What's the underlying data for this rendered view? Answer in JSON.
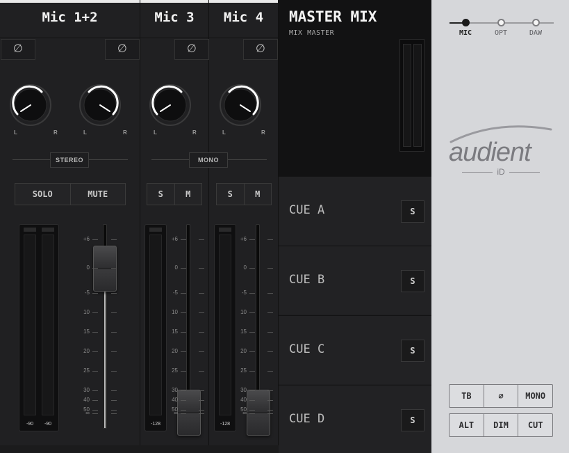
{
  "channels": [
    {
      "name": "Mic 1+2",
      "mode": "STEREO",
      "buttons": [
        "SOLO",
        "MUTE"
      ],
      "meter_peaks": [
        "-90",
        "-90"
      ],
      "knob_labels": {
        "left": "L",
        "right": "R"
      },
      "pan": [
        -0.8,
        0.8
      ]
    },
    {
      "name": "Mic 3",
      "mode": "MONO",
      "buttons": [
        "S",
        "M"
      ],
      "meter_peaks": [
        "-128"
      ],
      "knob_labels": {
        "left": "L",
        "right": "R"
      },
      "pan": [
        -0.8
      ]
    },
    {
      "name": "Mic 4",
      "mode": "",
      "buttons": [
        "S",
        "M"
      ],
      "meter_peaks": [
        "-128"
      ],
      "knob_labels": {
        "left": "L",
        "right": "R"
      },
      "pan": [
        0.8
      ]
    }
  ],
  "phase_symbol": "∅",
  "fader_scale": [
    "+6",
    "0",
    "-5",
    "10",
    "15",
    "20",
    "25",
    "30",
    "40",
    "50",
    "∞"
  ],
  "master": {
    "title": "MASTER MIX",
    "subtitle": "MIX MASTER",
    "cues": [
      {
        "label": "CUE A",
        "solo": "S"
      },
      {
        "label": "CUE B",
        "solo": "S"
      },
      {
        "label": "CUE C",
        "solo": "S"
      },
      {
        "label": "CUE D",
        "solo": "S"
      }
    ]
  },
  "source_selector": {
    "options": [
      "MIC",
      "OPT",
      "DAW"
    ],
    "selected": "MIC"
  },
  "logo": {
    "brand": "audient",
    "model": "iD"
  },
  "monitor_controls": {
    "row1": [
      "TB",
      "∅",
      "MONO"
    ],
    "row2": [
      "ALT",
      "DIM",
      "CUT"
    ]
  },
  "colors": {
    "accent": "#e9e9e9",
    "panel": "#d6d7da",
    "strip": "#202022"
  }
}
